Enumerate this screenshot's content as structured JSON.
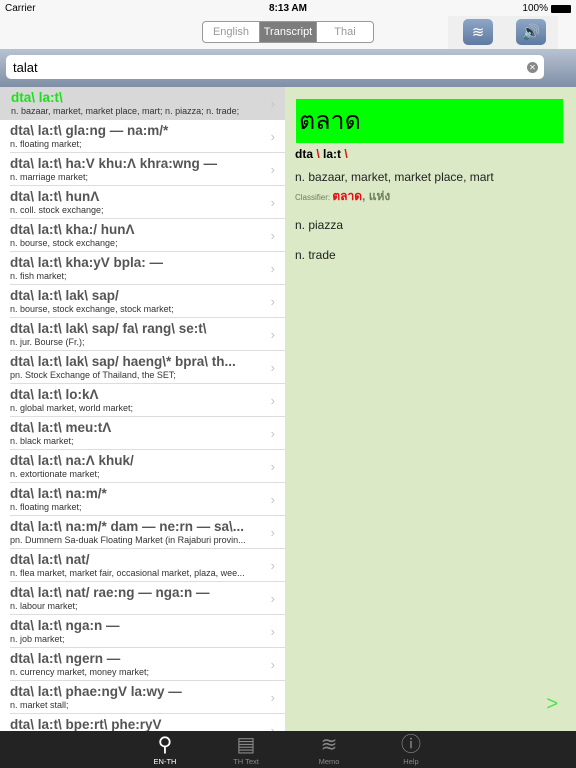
{
  "status": {
    "carrier": "Carrier",
    "time": "8:13 AM",
    "battery": "100%"
  },
  "segment": {
    "options": [
      "English",
      "Transcript",
      "Thai"
    ],
    "selected": "Transcript"
  },
  "search": {
    "value": "talat"
  },
  "list": [
    {
      "head": "dta\\ la:t\\",
      "sub": "n. bazaar, market, market place, mart; n. piazza; n. trade;"
    },
    {
      "head": "dta\\ la:t\\ gla:ng — na:m/*",
      "sub": "n. floating market;"
    },
    {
      "head": "dta\\ la:t\\ ha:V khu:Λ khra:wng —",
      "sub": "n. marriage market;"
    },
    {
      "head": "dta\\ la:t\\ hunΛ",
      "sub": "n. coll. stock exchange;"
    },
    {
      "head": "dta\\ la:t\\ kha:/ hunΛ",
      "sub": "n. bourse, stock exchange;"
    },
    {
      "head": "dta\\ la:t\\ kha:yV bpla: —",
      "sub": "n. fish market;"
    },
    {
      "head": "dta\\ la:t\\ lak\\ sap/",
      "sub": "n. bourse, stock exchange, stock market;"
    },
    {
      "head": "dta\\ la:t\\ lak\\ sap/ fa\\ rang\\ se:t\\",
      "sub": "n. jur. Bourse (Fr.);"
    },
    {
      "head": "dta\\ la:t\\ lak\\ sap/ haeng\\* bpra\\ th...",
      "sub": "pn. Stock Exchange of Thailand, the SET;"
    },
    {
      "head": "dta\\ la:t\\ lo:kΛ",
      "sub": "n. global market, world market;"
    },
    {
      "head": "dta\\ la:t\\ meu:tΛ",
      "sub": "n. black market;"
    },
    {
      "head": "dta\\ la:t\\ na:Λ khuk/",
      "sub": "n. extortionate market;"
    },
    {
      "head": "dta\\ la:t\\ na:m/*",
      "sub": "n. floating market;"
    },
    {
      "head": "dta\\ la:t\\ na:m/* dam — ne:rn — sa\\...",
      "sub": "pn. Dumnern Sa-duak Floating Market (in Rajaburi provin..."
    },
    {
      "head": "dta\\ la:t\\ nat/",
      "sub": "n. flea market, market fair, occasional market, plaza, wee..."
    },
    {
      "head": "dta\\ la:t\\ nat/ rae:ng — nga:n —",
      "sub": "n. labour market;"
    },
    {
      "head": "dta\\ la:t\\ nga:n —",
      "sub": "n. job market;"
    },
    {
      "head": "dta\\ la:t\\ ngern —",
      "sub": "n. currency market, money market;"
    },
    {
      "head": "dta\\ la:t\\ phae:ngV la:wy —",
      "sub": "n. market stall;"
    },
    {
      "head": "dta\\ la:t\\ bpe:rt\\ phe:ryV",
      "sub": ""
    }
  ],
  "detail": {
    "thai": "ตลาด",
    "translit_parts": [
      "dta",
      " \\ ",
      "la:t",
      " \\"
    ],
    "def1": "n. bazaar, market, market place, mart",
    "classifier_label": "Classifier:",
    "classifier_red": "ตลาด",
    "classifier_rest": ", แห่ง",
    "def2": "n. piazza",
    "def3": "n. trade",
    "next": ">"
  },
  "tabs": [
    {
      "label": "EN-TH",
      "icon": "search-icon"
    },
    {
      "label": "TH Text",
      "icon": "document-icon"
    },
    {
      "label": "Memo",
      "icon": "layers-icon"
    },
    {
      "label": "Help",
      "icon": "info-icon"
    }
  ],
  "colors": {
    "highlight": "#00ff00",
    "accent_text": "#1be01b",
    "detail_bg": "#dbe9c6",
    "red": "#e01010"
  }
}
